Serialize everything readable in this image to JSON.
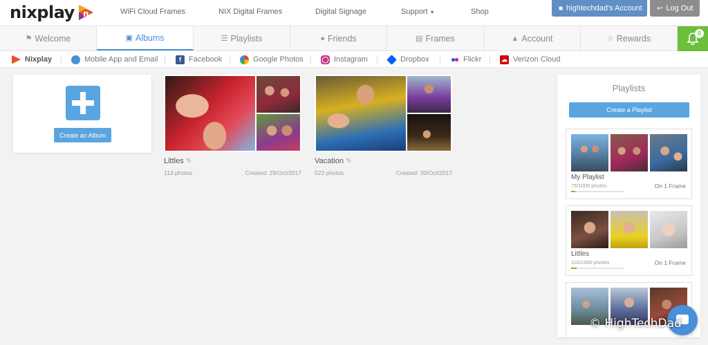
{
  "brand": {
    "logo_text": "nixplay",
    "accent": "#4a90d9",
    "green": "#6bbf3a"
  },
  "top_nav": {
    "links": [
      "WiFi Cloud Frames",
      "NIX Digital Frames",
      "Digital Signage",
      "Support",
      "Shop"
    ],
    "account_label": "hightechdad's Account",
    "logout_label": "Log Out"
  },
  "tabs": [
    {
      "label": "Welcome",
      "icon": "flag-icon"
    },
    {
      "label": "Albums",
      "icon": "camera-icon",
      "active": true
    },
    {
      "label": "Playlists",
      "icon": "list-icon"
    },
    {
      "label": "Friends",
      "icon": "users-icon"
    },
    {
      "label": "Frames",
      "icon": "picture-icon"
    },
    {
      "label": "Account",
      "icon": "user-icon"
    },
    {
      "label": "Rewards",
      "icon": "trophy-icon"
    }
  ],
  "notifications": {
    "count": "0"
  },
  "sources": [
    {
      "label": "Nixplay",
      "icon": "nixplay-icon",
      "color": "#e5532d"
    },
    {
      "label": "Mobile App and Email",
      "icon": "users-icon",
      "color": "#4a90d9"
    },
    {
      "label": "Facebook",
      "icon": "facebook-icon",
      "color": "#3b5998"
    },
    {
      "label": "Google Photos",
      "icon": "google-photos-icon",
      "color": "#f4b400"
    },
    {
      "label": "Instagram",
      "icon": "instagram-icon",
      "color": "#c13584"
    },
    {
      "label": "Dropbox",
      "icon": "dropbox-icon",
      "color": "#0061ff"
    },
    {
      "label": "Flickr",
      "icon": "flickr-icon",
      "color": "#ff0084"
    },
    {
      "label": "Verizon Cloud",
      "icon": "verizon-cloud-icon",
      "color": "#cd040b"
    }
  ],
  "create_album": {
    "label": "Create an Album"
  },
  "albums": [
    {
      "title": "Littles",
      "count": "113 photos",
      "created": "Created: 29/Oct/2017"
    },
    {
      "title": "Vacation",
      "count": "523 photos",
      "created": "Created: 30/Oct/2017"
    }
  ],
  "playlists_panel": {
    "title": "Playlists",
    "create_label": "Create a Playlist",
    "items": [
      {
        "name": "My Playlist",
        "count": "75/1000 photos",
        "progress": 0.075,
        "frames": "On 1 Frame"
      },
      {
        "name": "Littles",
        "count": "110/1000 photos",
        "progress": 0.11,
        "frames": "On 1 Frame"
      }
    ]
  },
  "watermark": "© HighTechDad"
}
